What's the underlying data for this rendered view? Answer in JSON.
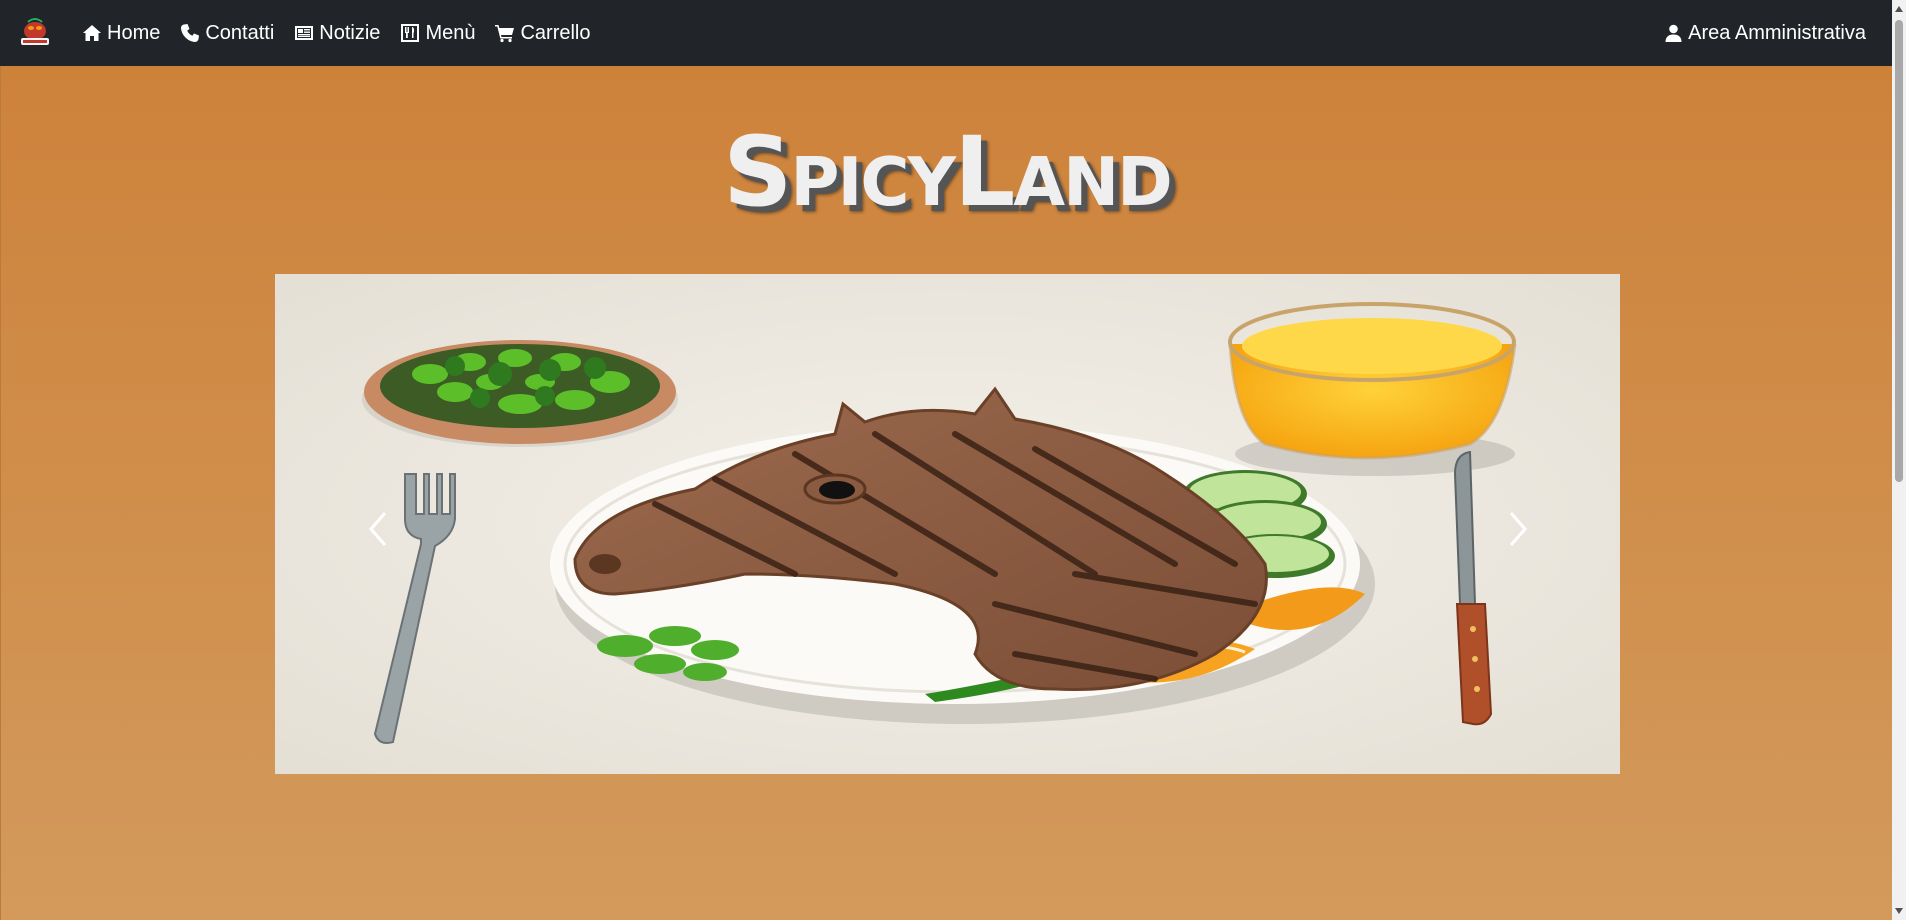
{
  "nav": {
    "items": [
      {
        "label": "Home",
        "icon": "home-icon"
      },
      {
        "label": "Contatti",
        "icon": "phone-icon"
      },
      {
        "label": "Notizie",
        "icon": "newspaper-icon"
      },
      {
        "label": "Menù",
        "icon": "menu-book-icon"
      },
      {
        "label": "Carrello",
        "icon": "cart-icon"
      }
    ],
    "admin_label": "Area Amministrativa",
    "admin_icon": "user-icon",
    "logo_text": "SPICYLAND"
  },
  "hero": {
    "title": "SpicyLand"
  },
  "carousel": {
    "prev_icon": "chevron-left-icon",
    "next_icon": "chevron-right-icon"
  },
  "colors": {
    "navbar": "#212529",
    "background": "#d0873f",
    "title": "#efefef"
  }
}
